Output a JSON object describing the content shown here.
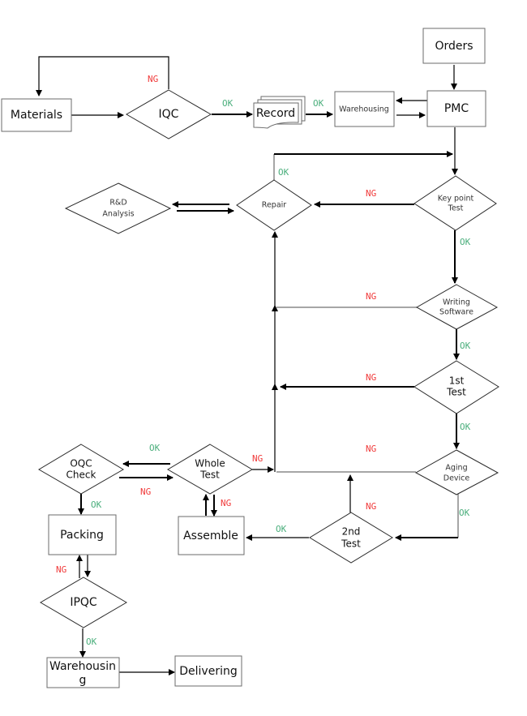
{
  "diagram": {
    "nodes": {
      "orders": "Orders",
      "materials": "Materials",
      "iqc": "IQC",
      "record": "Record",
      "warehousing_in": "Warehousing",
      "pmc": "PMC",
      "rd_analysis_1": "R&D",
      "rd_analysis_2": "Analysis",
      "repair": "Repair",
      "key_point_test_1": "Key point",
      "key_point_test_2": "Test",
      "writing_software_1": "Writing",
      "writing_software_2": "Software",
      "first_test_1": "1st",
      "first_test_2": "Test",
      "aging_device_1": "Aging",
      "aging_device_2": "Device",
      "second_test_1": "2nd",
      "second_test_2": "Test",
      "whole_test_1": "Whole",
      "whole_test_2": "Test",
      "oqc_check_1": "OQC",
      "oqc_check_2": "Check",
      "assemble": "Assemble",
      "packing": "Packing",
      "ipqc": "IPQC",
      "warehousing_out_1": "Warehousin",
      "warehousing_out_2": "g",
      "delivering": "Delivering"
    },
    "edge_labels": {
      "iqc_ng": "NG",
      "iqc_ok": "OK",
      "record_ok": "OK",
      "repair_ok": "OK",
      "keypoint_ng": "NG",
      "keypoint_ok": "OK",
      "writing_ng": "NG",
      "writing_ok": "OK",
      "first_ng": "NG",
      "first_ok": "OK",
      "aging_ng": "NG",
      "aging_ok": "OK",
      "second_ng": "NG",
      "second_ok": "OK",
      "whole_ng_right": "NG",
      "whole_ok": "OK",
      "oqc_ng": "NG",
      "assemble_ng": "NG",
      "oqc_ok": "OK",
      "ipqc_ng": "NG",
      "ipqc_ok": "OK"
    },
    "colors": {
      "ok": "#4caf7d",
      "ng": "#f03a3a"
    }
  }
}
